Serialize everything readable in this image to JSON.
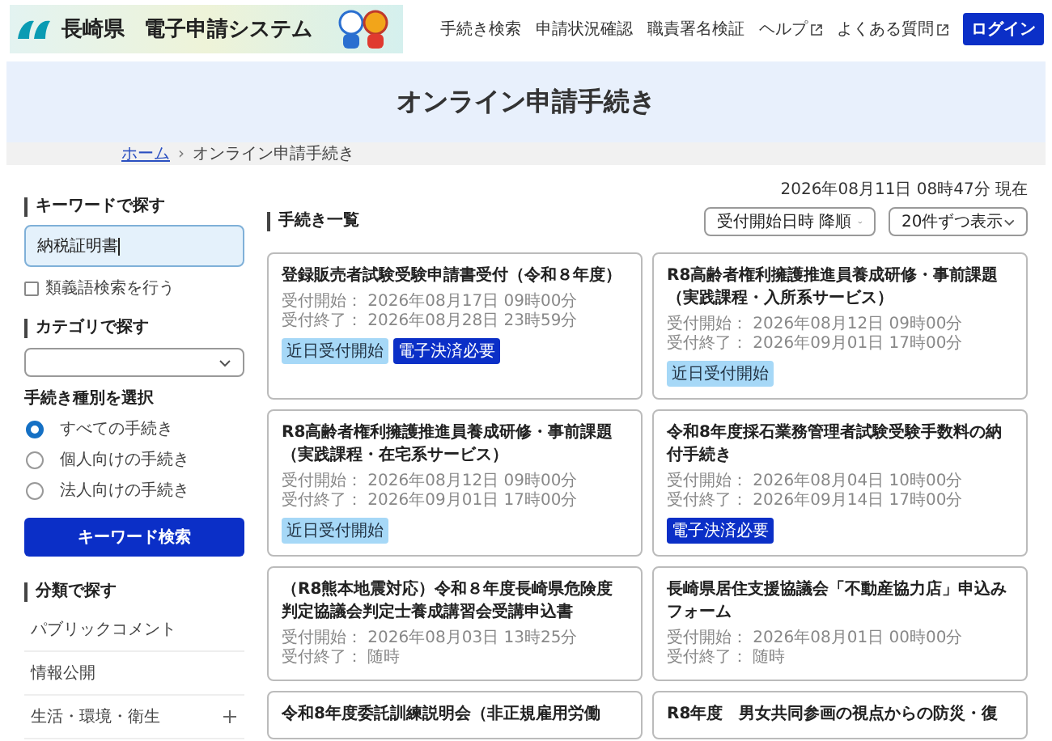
{
  "header": {
    "logo_text": "長崎県",
    "system_name": "電子申請システム",
    "nav": [
      {
        "label": "手続き検索",
        "external": false
      },
      {
        "label": "申請状況確認",
        "external": false
      },
      {
        "label": "職責署名検証",
        "external": false
      },
      {
        "label": "ヘルプ",
        "external": true
      },
      {
        "label": "よくある質問",
        "external": true
      }
    ],
    "login_button": "ログイン"
  },
  "banner": {
    "title": "オンライン申請手続き"
  },
  "breadcrumb": {
    "separator": "›",
    "items": [
      {
        "label": "ホーム",
        "link": true
      },
      {
        "label": "オンライン申請手続き",
        "link": false
      }
    ]
  },
  "sidebar": {
    "keyword_heading": "キーワードで探す",
    "keyword_value": "納税証明書",
    "synonym": {
      "label": "類義語検索を行う",
      "checked": false
    },
    "category_heading": "カテゴリで探す",
    "type_heading": "手続き種別を選択",
    "types": [
      {
        "label": "すべての手続き",
        "selected": true
      },
      {
        "label": "個人向けの手続き",
        "selected": false
      },
      {
        "label": "法人向けの手続き",
        "selected": false
      }
    ],
    "search_button": "キーワード検索",
    "classification_heading": "分類で探す",
    "classifications": [
      {
        "label": "パブリックコメント",
        "expandable": false
      },
      {
        "label": "情報公開",
        "expandable": false
      },
      {
        "label": "生活・環境・衛生",
        "expandable": true
      }
    ]
  },
  "main": {
    "timestamp": "2026年08月11日 08時47分 現在",
    "heading": "手続き一覧",
    "sort": "受付開始日時 降順",
    "per_page": "20件ずつ表示",
    "cards": [
      {
        "title": "登録販売者試験受験申請書受付（令和８年度）",
        "start": "受付開始： 2026年08月17日 09時00分",
        "end": "受付終了： 2026年08月28日 23時59分",
        "badges": [
          {
            "label": "近日受付開始",
            "kind": "soon"
          },
          {
            "label": "電子決済必要",
            "kind": "payment"
          }
        ]
      },
      {
        "title": "R8高齢者権利擁護推進員養成研修・事前課題（実践課程・入所系サービス）",
        "start": "受付開始： 2026年08月12日 09時00分",
        "end": "受付終了： 2026年09月01日 17時00分",
        "badges": [
          {
            "label": "近日受付開始",
            "kind": "soon"
          }
        ]
      },
      {
        "title": "R8高齢者権利擁護推進員養成研修・事前課題（実践課程・在宅系サービス）",
        "start": "受付開始： 2026年08月12日 09時00分",
        "end": "受付終了： 2026年09月01日 17時00分",
        "badges": [
          {
            "label": "近日受付開始",
            "kind": "soon"
          }
        ]
      },
      {
        "title": "令和8年度採石業務管理者試験受験手数料の納付手続き",
        "start": "受付開始： 2026年08月04日 10時00分",
        "end": "受付終了： 2026年09月14日 17時00分",
        "badges": [
          {
            "label": "電子決済必要",
            "kind": "payment"
          }
        ]
      },
      {
        "title": "（R8熊本地震対応）令和８年度長崎県危険度判定協議会判定士養成講習会受講申込書",
        "start": "受付開始： 2026年08月03日 13時25分",
        "end": "受付終了： 随時"
      },
      {
        "title": "長崎県居住支援協議会「不動産協力店」申込みフォーム",
        "start": "受付開始： 2026年08月01日 00時00分",
        "end": "受付終了： 随時"
      },
      {
        "title": "令和8年度委託訓練説明会（非正規雇用労働"
      },
      {
        "title": "R8年度　男女共同参画の視点からの防災・復"
      }
    ]
  }
}
